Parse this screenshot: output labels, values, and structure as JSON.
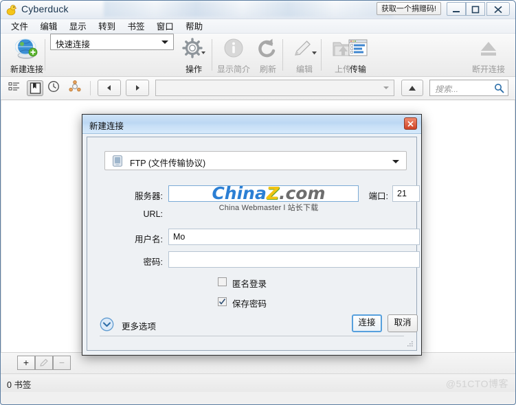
{
  "window": {
    "app_icon": "duck-icon",
    "title": "Cyberduck",
    "donate_button": "获取一个捐赠码!",
    "minimize": "minimize-icon",
    "maximize": "maximize-icon",
    "close": "close-icon"
  },
  "menubar": {
    "items": [
      {
        "label": "文件"
      },
      {
        "label": "编辑"
      },
      {
        "label": "显示"
      },
      {
        "label": "转到"
      },
      {
        "label": "书签"
      },
      {
        "label": "窗口"
      },
      {
        "label": "帮助"
      }
    ]
  },
  "toolbar": {
    "items": [
      {
        "label": "新建连接",
        "icon": "globe-new-connection-icon",
        "disabled": false
      },
      {
        "label": "操作",
        "icon": "gear-icon",
        "disabled": false
      },
      {
        "label": "显示简介",
        "icon": "info-icon",
        "disabled": true
      },
      {
        "label": "刷新",
        "icon": "refresh-icon",
        "disabled": true
      },
      {
        "label": "编辑",
        "icon": "pencil-icon",
        "disabled": true
      },
      {
        "label": "上传",
        "icon": "upload-folder-icon",
        "disabled": true
      },
      {
        "label": "传输",
        "icon": "transfers-window-icon",
        "disabled": false
      },
      {
        "label": "断开连接",
        "icon": "eject-icon",
        "disabled": true
      }
    ],
    "quick_connect": {
      "value": "快速连接",
      "icon": "chevron-down-icon"
    }
  },
  "navbar": {
    "bookmark_icons": [
      {
        "name": "bookmark-list-icon",
        "selected": false
      },
      {
        "name": "bookmarks-icon",
        "selected": true
      },
      {
        "name": "history-clock-icon",
        "selected": false
      },
      {
        "name": "bonjour-icon",
        "selected": false
      }
    ],
    "back": "back-arrow-icon",
    "forward": "forward-arrow-icon",
    "path_value": "",
    "up": "up-arrow-icon",
    "search": {
      "placeholder": "搜索...",
      "value": "",
      "icon": "magnifier-icon"
    }
  },
  "dialog": {
    "title": "新建连接",
    "close_label": "x",
    "protocol": {
      "label": "FTP (文件传输协议)",
      "icon": "server-icon"
    },
    "fields": {
      "server_label": "服务器:",
      "server_value": "",
      "port_label": "端口:",
      "port_value": "21",
      "url_label": "URL:",
      "url_value": "",
      "username_label": "用户名:",
      "username_value": "Mo",
      "password_label": "密码:",
      "password_value": ""
    },
    "checkboxes": [
      {
        "label": "匿名登录",
        "checked": false
      },
      {
        "label": "保存密码",
        "checked": true
      }
    ],
    "buttons": {
      "connect": "连接",
      "cancel": "取消"
    },
    "more_options": {
      "label": "更多选项",
      "icon": "chevron-down-circle-icon",
      "expanded": false
    }
  },
  "bottombar": {
    "add_label": "+",
    "edit_label": "pencil",
    "remove_label": "−"
  },
  "statusbar": {
    "text": "0 书签",
    "watermark": "@51CTO博客"
  },
  "watermark": {
    "part1": "China",
    "part2": "Z",
    "part3": ".com",
    "subtitle": "China Webmaster l 站长下载"
  },
  "colors": {
    "dialog_title": "#bcd8f3",
    "accent_blue": "#56a0dd",
    "close_red": "#cf4326",
    "chinaz_blue": "#2b7fd4",
    "chinaz_yellow": "#f2c312"
  }
}
